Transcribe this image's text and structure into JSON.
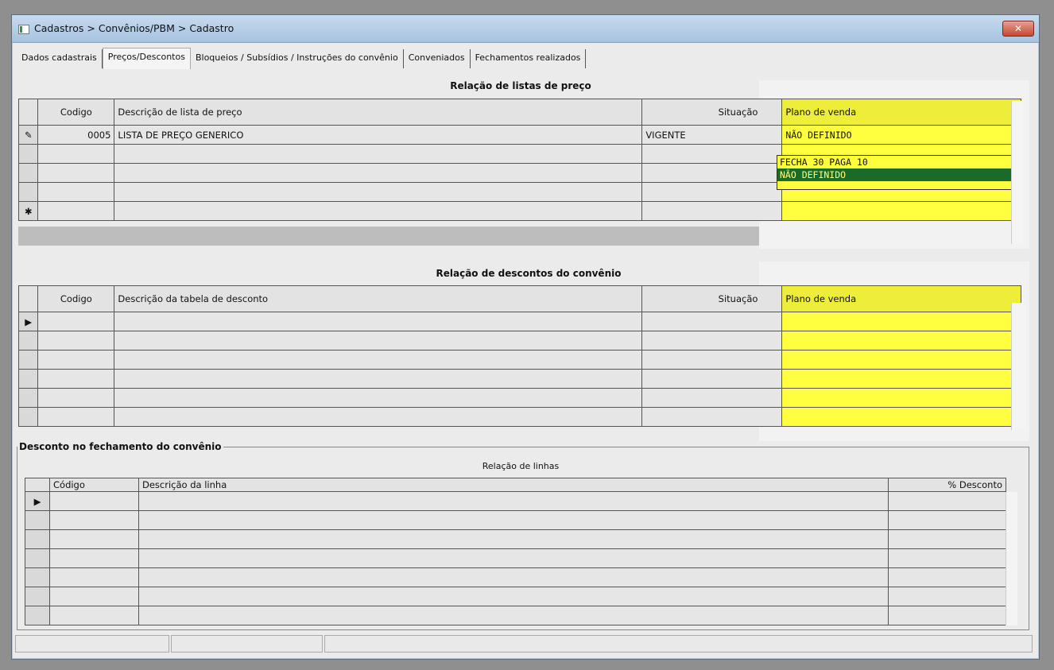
{
  "window": {
    "title": "Cadastros > Convênios/PBM > Cadastro",
    "close_label": "✕"
  },
  "tabs": [
    {
      "label": "Dados cadastrais"
    },
    {
      "label": "Preços/Descontos"
    },
    {
      "label": "Bloqueios / Subsídios / Instruções do convênio"
    },
    {
      "label": "Conveniados"
    },
    {
      "label": "Fechamentos realizados"
    }
  ],
  "price_lists": {
    "title": "Relação de listas de preço",
    "columns": {
      "code": "Codigo",
      "description": "Descrição de lista de preço",
      "status": "Situação",
      "sales_plan": "Plano de venda"
    },
    "rows": [
      {
        "indicator": "✎",
        "code": "0005",
        "description": "LISTA DE PREÇO GENERICO",
        "status": "VIGENTE",
        "sales_plan": "NÃO DEFINIDO"
      }
    ],
    "dropdown_options": [
      "FECHA 30 PAGA 10",
      "NÃO DEFINIDO"
    ],
    "new_row_indicator": "✱"
  },
  "discounts": {
    "title": "Relação de descontos do convênio",
    "columns": {
      "code": "Codigo",
      "description": "Descrição da tabela de desconto",
      "status": "Situação",
      "sales_plan": "Plano de venda"
    },
    "current_indicator": "▶"
  },
  "closing_discount": {
    "legend": "Desconto no fechamento do convênio",
    "lines_title": "Relação de linhas",
    "columns": {
      "code": "Código",
      "description": "Descrição da linha",
      "discount": "% Desconto"
    },
    "current_indicator": "▶"
  },
  "colors": {
    "highlight_yellow": "#ffff40",
    "selected_green": "#1a6a2a"
  }
}
